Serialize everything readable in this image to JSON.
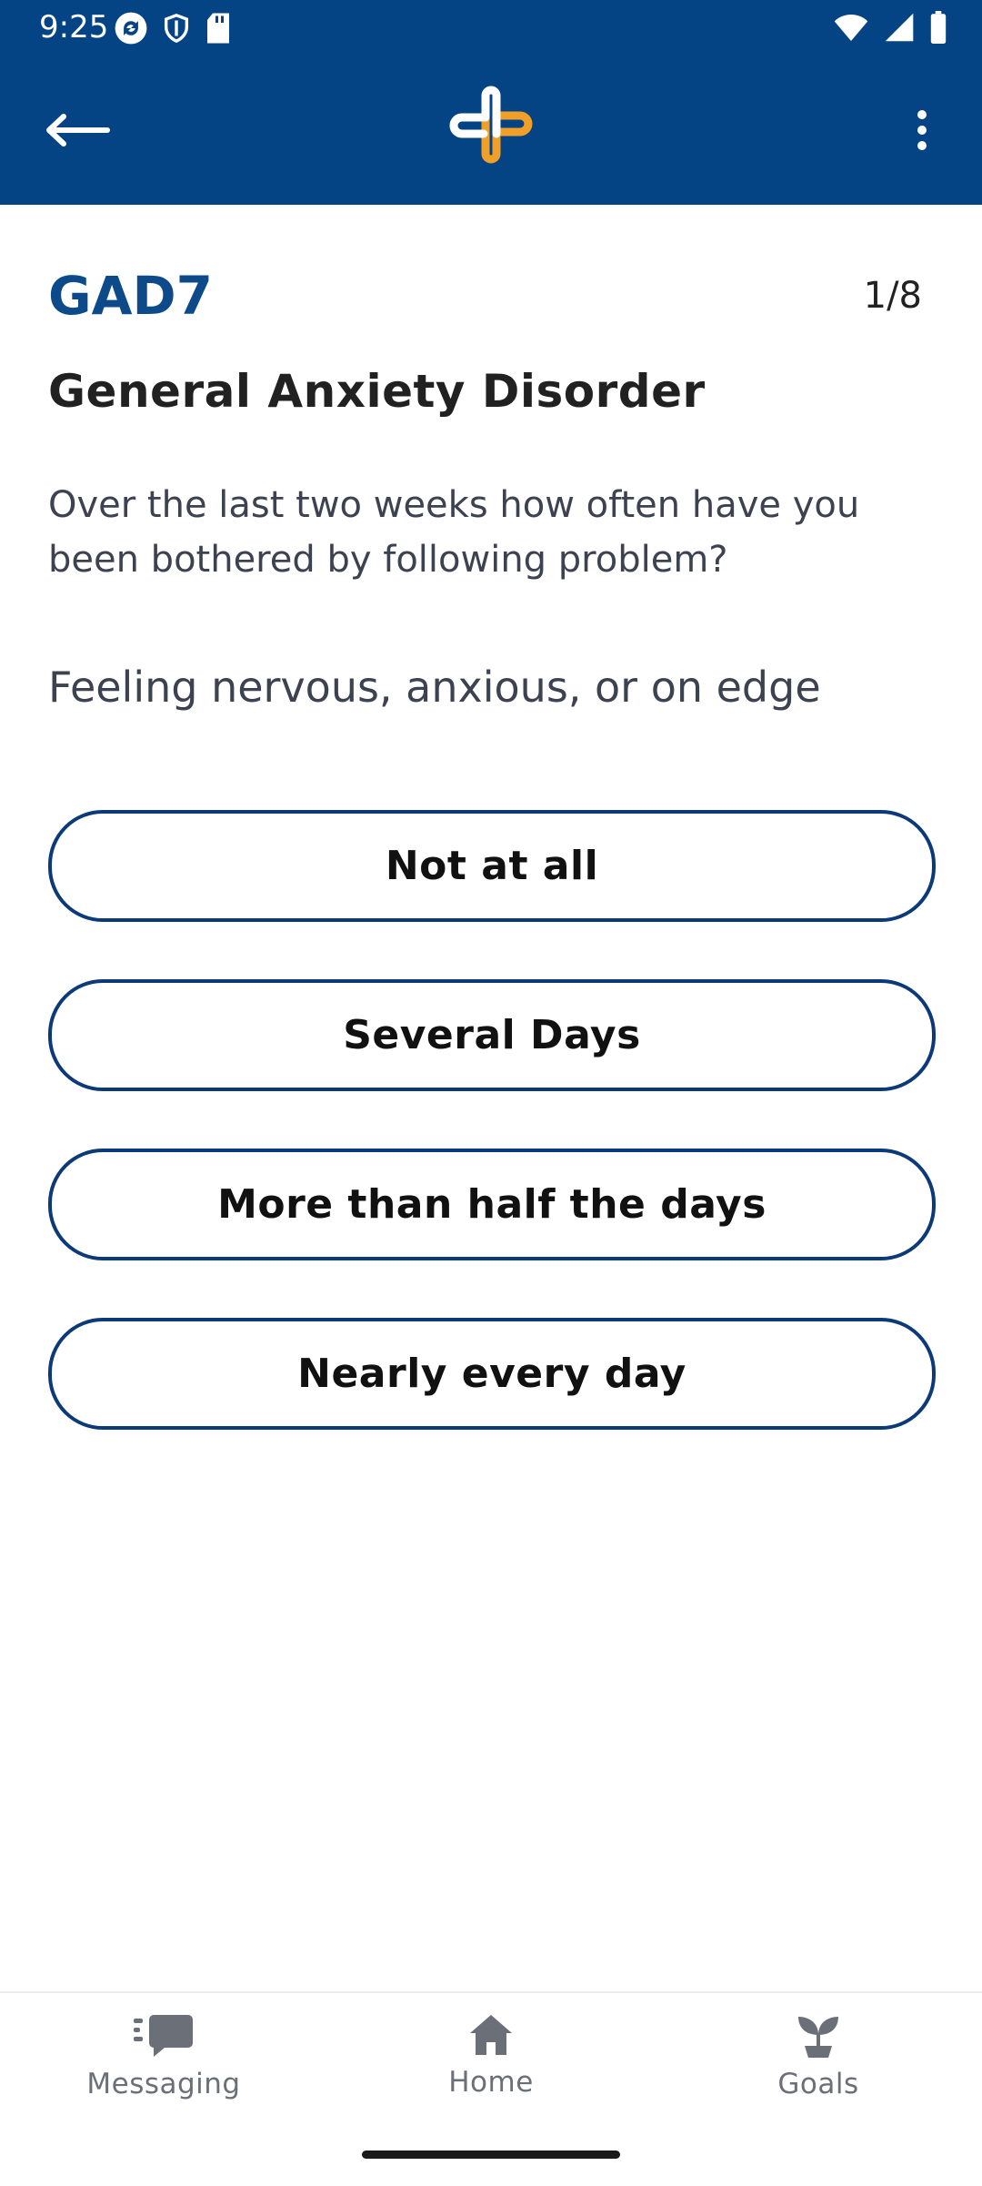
{
  "status_bar": {
    "time": "9:25",
    "left_icons": [
      "sync-icon",
      "shield-icon",
      "sd-card-icon"
    ],
    "right_icons": [
      "wifi-icon",
      "signal-icon",
      "battery-icon"
    ]
  },
  "app_bar": {
    "back_icon": "arrow-left-icon",
    "logo_icon": "app-logo-cross-icon",
    "menu_icon": "more-vertical-icon",
    "colors": {
      "background": "#044384",
      "logo_blue": "#ffffff",
      "logo_orange": "#F0A029"
    }
  },
  "survey": {
    "code": "GAD7",
    "progress": "1/8",
    "title": "General Anxiety Disorder",
    "instruction": "Over the last two weeks how often have you been bothered by following problem?",
    "question": "Feeling nervous, anxious, or on edge",
    "options": [
      {
        "label": "Not at all"
      },
      {
        "label": "Several Days"
      },
      {
        "label": "More than half the days"
      },
      {
        "label": "Nearly every day"
      }
    ],
    "colors": {
      "code": "#0C4A8A",
      "option_border": "#0C3A78"
    }
  },
  "bottom_nav": {
    "items": [
      {
        "label": "Messaging",
        "icon": "chat-icon"
      },
      {
        "label": "Home",
        "icon": "home-icon"
      },
      {
        "label": "Goals",
        "icon": "sprout-icon"
      }
    ]
  }
}
